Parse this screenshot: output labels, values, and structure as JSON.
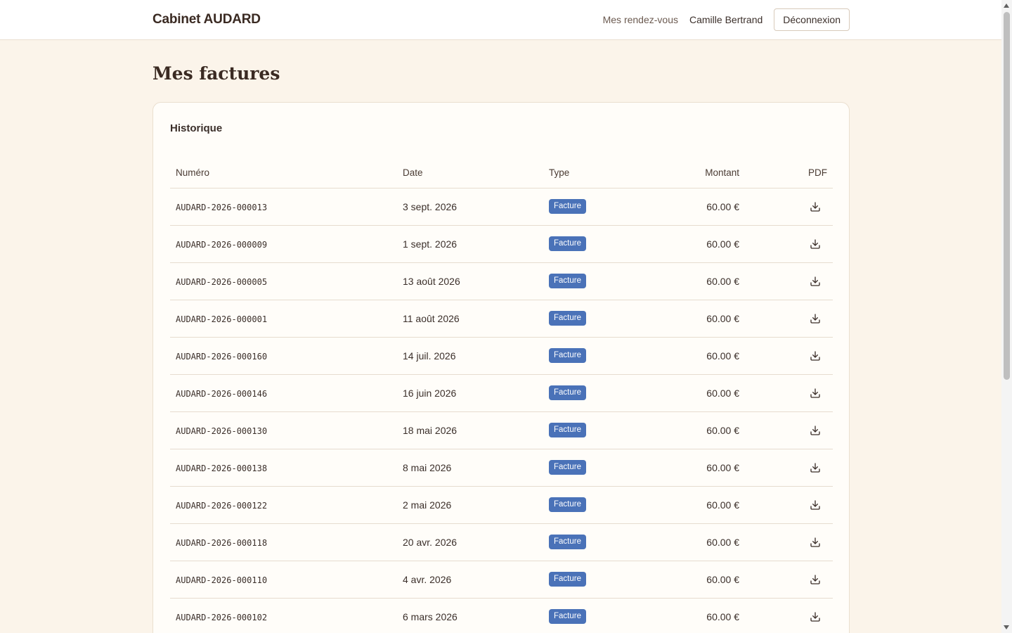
{
  "header": {
    "brand": "Cabinet AUDARD",
    "nav_appointments": "Mes rendez-vous",
    "user_name": "Camille Bertrand",
    "logout_label": "Déconnexion"
  },
  "page": {
    "title": "Mes factures"
  },
  "card": {
    "title": "Historique",
    "columns": {
      "number": "Numéro",
      "date": "Date",
      "type": "Type",
      "amount": "Montant",
      "pdf": "PDF"
    },
    "rows": [
      {
        "number": "AUDARD-2026-000013",
        "date": "3 sept. 2026",
        "type": "Facture",
        "amount": "60.00 €"
      },
      {
        "number": "AUDARD-2026-000009",
        "date": "1 sept. 2026",
        "type": "Facture",
        "amount": "60.00 €"
      },
      {
        "number": "AUDARD-2026-000005",
        "date": "13 août 2026",
        "type": "Facture",
        "amount": "60.00 €"
      },
      {
        "number": "AUDARD-2026-000001",
        "date": "11 août 2026",
        "type": "Facture",
        "amount": "60.00 €"
      },
      {
        "number": "AUDARD-2026-000160",
        "date": "14 juil. 2026",
        "type": "Facture",
        "amount": "60.00 €"
      },
      {
        "number": "AUDARD-2026-000146",
        "date": "16 juin 2026",
        "type": "Facture",
        "amount": "60.00 €"
      },
      {
        "number": "AUDARD-2026-000130",
        "date": "18 mai 2026",
        "type": "Facture",
        "amount": "60.00 €"
      },
      {
        "number": "AUDARD-2026-000138",
        "date": "8 mai 2026",
        "type": "Facture",
        "amount": "60.00 €"
      },
      {
        "number": "AUDARD-2026-000122",
        "date": "2 mai 2026",
        "type": "Facture",
        "amount": "60.00 €"
      },
      {
        "number": "AUDARD-2026-000118",
        "date": "20 avr. 2026",
        "type": "Facture",
        "amount": "60.00 €"
      },
      {
        "number": "AUDARD-2026-000110",
        "date": "4 avr. 2026",
        "type": "Facture",
        "amount": "60.00 €"
      },
      {
        "number": "AUDARD-2026-000102",
        "date": "6 mars 2026",
        "type": "Facture",
        "amount": "60.00 €"
      }
    ]
  },
  "icons": {
    "row_pdf_icon": "download-icon"
  },
  "colors": {
    "background": "#fbf4ea",
    "badge": "#4a72b8",
    "text": "#3b2f2a"
  }
}
